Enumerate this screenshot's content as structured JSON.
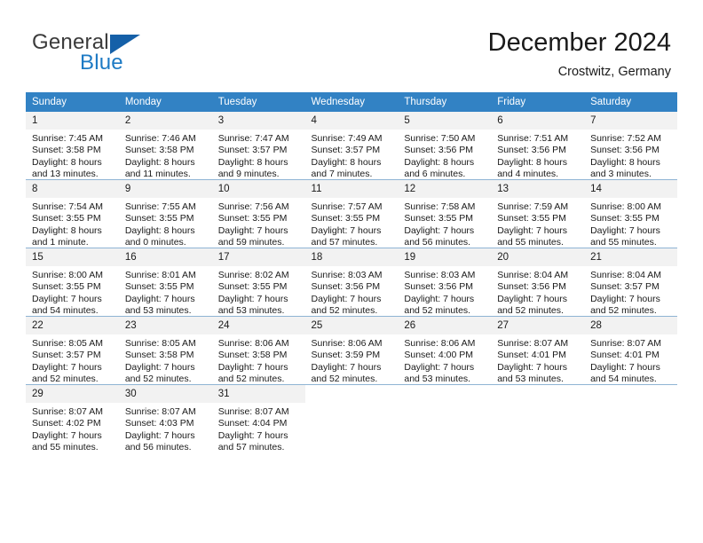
{
  "brand": {
    "name_top": "General",
    "name_bottom": "Blue",
    "color_dark": "#3b3b3b",
    "color_blue": "#1d7ac4",
    "triangle_color": "#1560a8"
  },
  "header": {
    "title": "December 2024",
    "location": "Crostwitz, Germany"
  },
  "theme": {
    "header_bg": "#3282c4",
    "header_text": "#ffffff",
    "daynum_bg": "#f2f2f2",
    "row_divider": "#8fb4d4",
    "body_text": "#1a1a1a"
  },
  "weekdays": [
    "Sunday",
    "Monday",
    "Tuesday",
    "Wednesday",
    "Thursday",
    "Friday",
    "Saturday"
  ],
  "labels": {
    "sunrise_prefix": "Sunrise:",
    "sunset_prefix": "Sunset:",
    "daylight_prefix": "Daylight:"
  },
  "weeks": [
    [
      {
        "day": "1",
        "sunrise": "Sunrise: 7:45 AM",
        "sunset": "Sunset: 3:58 PM",
        "daylight_line1": "Daylight: 8 hours",
        "daylight_line2": "and 13 minutes."
      },
      {
        "day": "2",
        "sunrise": "Sunrise: 7:46 AM",
        "sunset": "Sunset: 3:58 PM",
        "daylight_line1": "Daylight: 8 hours",
        "daylight_line2": "and 11 minutes."
      },
      {
        "day": "3",
        "sunrise": "Sunrise: 7:47 AM",
        "sunset": "Sunset: 3:57 PM",
        "daylight_line1": "Daylight: 8 hours",
        "daylight_line2": "and 9 minutes."
      },
      {
        "day": "4",
        "sunrise": "Sunrise: 7:49 AM",
        "sunset": "Sunset: 3:57 PM",
        "daylight_line1": "Daylight: 8 hours",
        "daylight_line2": "and 7 minutes."
      },
      {
        "day": "5",
        "sunrise": "Sunrise: 7:50 AM",
        "sunset": "Sunset: 3:56 PM",
        "daylight_line1": "Daylight: 8 hours",
        "daylight_line2": "and 6 minutes."
      },
      {
        "day": "6",
        "sunrise": "Sunrise: 7:51 AM",
        "sunset": "Sunset: 3:56 PM",
        "daylight_line1": "Daylight: 8 hours",
        "daylight_line2": "and 4 minutes."
      },
      {
        "day": "7",
        "sunrise": "Sunrise: 7:52 AM",
        "sunset": "Sunset: 3:56 PM",
        "daylight_line1": "Daylight: 8 hours",
        "daylight_line2": "and 3 minutes."
      }
    ],
    [
      {
        "day": "8",
        "sunrise": "Sunrise: 7:54 AM",
        "sunset": "Sunset: 3:55 PM",
        "daylight_line1": "Daylight: 8 hours",
        "daylight_line2": "and 1 minute."
      },
      {
        "day": "9",
        "sunrise": "Sunrise: 7:55 AM",
        "sunset": "Sunset: 3:55 PM",
        "daylight_line1": "Daylight: 8 hours",
        "daylight_line2": "and 0 minutes."
      },
      {
        "day": "10",
        "sunrise": "Sunrise: 7:56 AM",
        "sunset": "Sunset: 3:55 PM",
        "daylight_line1": "Daylight: 7 hours",
        "daylight_line2": "and 59 minutes."
      },
      {
        "day": "11",
        "sunrise": "Sunrise: 7:57 AM",
        "sunset": "Sunset: 3:55 PM",
        "daylight_line1": "Daylight: 7 hours",
        "daylight_line2": "and 57 minutes."
      },
      {
        "day": "12",
        "sunrise": "Sunrise: 7:58 AM",
        "sunset": "Sunset: 3:55 PM",
        "daylight_line1": "Daylight: 7 hours",
        "daylight_line2": "and 56 minutes."
      },
      {
        "day": "13",
        "sunrise": "Sunrise: 7:59 AM",
        "sunset": "Sunset: 3:55 PM",
        "daylight_line1": "Daylight: 7 hours",
        "daylight_line2": "and 55 minutes."
      },
      {
        "day": "14",
        "sunrise": "Sunrise: 8:00 AM",
        "sunset": "Sunset: 3:55 PM",
        "daylight_line1": "Daylight: 7 hours",
        "daylight_line2": "and 55 minutes."
      }
    ],
    [
      {
        "day": "15",
        "sunrise": "Sunrise: 8:00 AM",
        "sunset": "Sunset: 3:55 PM",
        "daylight_line1": "Daylight: 7 hours",
        "daylight_line2": "and 54 minutes."
      },
      {
        "day": "16",
        "sunrise": "Sunrise: 8:01 AM",
        "sunset": "Sunset: 3:55 PM",
        "daylight_line1": "Daylight: 7 hours",
        "daylight_line2": "and 53 minutes."
      },
      {
        "day": "17",
        "sunrise": "Sunrise: 8:02 AM",
        "sunset": "Sunset: 3:55 PM",
        "daylight_line1": "Daylight: 7 hours",
        "daylight_line2": "and 53 minutes."
      },
      {
        "day": "18",
        "sunrise": "Sunrise: 8:03 AM",
        "sunset": "Sunset: 3:56 PM",
        "daylight_line1": "Daylight: 7 hours",
        "daylight_line2": "and 52 minutes."
      },
      {
        "day": "19",
        "sunrise": "Sunrise: 8:03 AM",
        "sunset": "Sunset: 3:56 PM",
        "daylight_line1": "Daylight: 7 hours",
        "daylight_line2": "and 52 minutes."
      },
      {
        "day": "20",
        "sunrise": "Sunrise: 8:04 AM",
        "sunset": "Sunset: 3:56 PM",
        "daylight_line1": "Daylight: 7 hours",
        "daylight_line2": "and 52 minutes."
      },
      {
        "day": "21",
        "sunrise": "Sunrise: 8:04 AM",
        "sunset": "Sunset: 3:57 PM",
        "daylight_line1": "Daylight: 7 hours",
        "daylight_line2": "and 52 minutes."
      }
    ],
    [
      {
        "day": "22",
        "sunrise": "Sunrise: 8:05 AM",
        "sunset": "Sunset: 3:57 PM",
        "daylight_line1": "Daylight: 7 hours",
        "daylight_line2": "and 52 minutes."
      },
      {
        "day": "23",
        "sunrise": "Sunrise: 8:05 AM",
        "sunset": "Sunset: 3:58 PM",
        "daylight_line1": "Daylight: 7 hours",
        "daylight_line2": "and 52 minutes."
      },
      {
        "day": "24",
        "sunrise": "Sunrise: 8:06 AM",
        "sunset": "Sunset: 3:58 PM",
        "daylight_line1": "Daylight: 7 hours",
        "daylight_line2": "and 52 minutes."
      },
      {
        "day": "25",
        "sunrise": "Sunrise: 8:06 AM",
        "sunset": "Sunset: 3:59 PM",
        "daylight_line1": "Daylight: 7 hours",
        "daylight_line2": "and 52 minutes."
      },
      {
        "day": "26",
        "sunrise": "Sunrise: 8:06 AM",
        "sunset": "Sunset: 4:00 PM",
        "daylight_line1": "Daylight: 7 hours",
        "daylight_line2": "and 53 minutes."
      },
      {
        "day": "27",
        "sunrise": "Sunrise: 8:07 AM",
        "sunset": "Sunset: 4:01 PM",
        "daylight_line1": "Daylight: 7 hours",
        "daylight_line2": "and 53 minutes."
      },
      {
        "day": "28",
        "sunrise": "Sunrise: 8:07 AM",
        "sunset": "Sunset: 4:01 PM",
        "daylight_line1": "Daylight: 7 hours",
        "daylight_line2": "and 54 minutes."
      }
    ],
    [
      {
        "day": "29",
        "sunrise": "Sunrise: 8:07 AM",
        "sunset": "Sunset: 4:02 PM",
        "daylight_line1": "Daylight: 7 hours",
        "daylight_line2": "and 55 minutes."
      },
      {
        "day": "30",
        "sunrise": "Sunrise: 8:07 AM",
        "sunset": "Sunset: 4:03 PM",
        "daylight_line1": "Daylight: 7 hours",
        "daylight_line2": "and 56 minutes."
      },
      {
        "day": "31",
        "sunrise": "Sunrise: 8:07 AM",
        "sunset": "Sunset: 4:04 PM",
        "daylight_line1": "Daylight: 7 hours",
        "daylight_line2": "and 57 minutes."
      },
      {
        "day": "",
        "sunrise": "",
        "sunset": "",
        "daylight_line1": "",
        "daylight_line2": ""
      },
      {
        "day": "",
        "sunrise": "",
        "sunset": "",
        "daylight_line1": "",
        "daylight_line2": ""
      },
      {
        "day": "",
        "sunrise": "",
        "sunset": "",
        "daylight_line1": "",
        "daylight_line2": ""
      },
      {
        "day": "",
        "sunrise": "",
        "sunset": "",
        "daylight_line1": "",
        "daylight_line2": ""
      }
    ]
  ]
}
